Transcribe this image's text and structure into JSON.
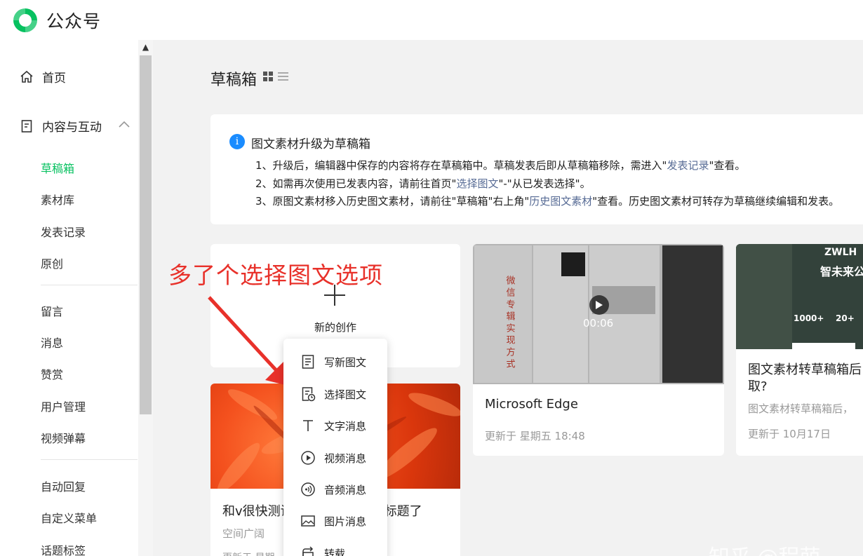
{
  "header": {
    "app_title": "公众号"
  },
  "sidebar": {
    "home_label": "首页",
    "content_label": "内容与互动",
    "items": [
      {
        "label": "草稿箱"
      },
      {
        "label": "素材库"
      },
      {
        "label": "发表记录"
      },
      {
        "label": "原创"
      },
      {
        "label": "留言"
      },
      {
        "label": "消息"
      },
      {
        "label": "赞赏"
      },
      {
        "label": "用户管理"
      },
      {
        "label": "视频弹幕"
      },
      {
        "label": "自动回复"
      },
      {
        "label": "自定义菜单"
      },
      {
        "label": "话题标签"
      }
    ],
    "active_item": "草稿箱"
  },
  "main": {
    "title": "草稿箱",
    "notice": {
      "title": "图文素材升级为草稿箱",
      "line1_a": "1、升级后，编辑器中保存的内容将存在草稿箱中。草稿发表后即从草稿箱移除，需进入\"",
      "line1_link": "发表记录",
      "line1_b": "\"查看。",
      "line2_a": "2、如需再次使用已发表内容，请前往首页\"",
      "line2_link": "选择图文",
      "line2_b": "\"-\"从已发表选择\"。",
      "line3_a": "3、原图文素材移入历史图文素材，请前往\"草稿箱\"右上角\"",
      "line3_link": "历史图文素材",
      "line3_b": "\"查看。历史图文素材可转存为草稿继续编辑和发表。"
    },
    "new_card_label": "新的创作",
    "annotation": "多了个选择图文选项",
    "menu": [
      {
        "label": "写新图文",
        "icon": "doc-icon"
      },
      {
        "label": "选择图文",
        "icon": "doc-clock-icon"
      },
      {
        "label": "文字消息",
        "icon": "text-icon"
      },
      {
        "label": "视频消息",
        "icon": "play-circle-icon"
      },
      {
        "label": "音频消息",
        "icon": "audio-icon"
      },
      {
        "label": "图片消息",
        "icon": "image-icon"
      },
      {
        "label": "转载",
        "icon": "repost-icon"
      }
    ],
    "cards": {
      "flower": {
        "title_a": "和v很快测试",
        "title_b": "标题了",
        "author": "空间广阔",
        "time": "更新于 星期"
      },
      "edge": {
        "title": "Microsoft Edge",
        "time": "更新于 星期五 18:48",
        "duration": "00:06",
        "thumb_text": "微信专辑实现方式"
      },
      "zw": {
        "brand": "ZWLH",
        "slogan": "智未来公众",
        "stat1": "1000+",
        "stat2": "20+",
        "title": "图文素材转草稿箱后",
        "title2": "取?",
        "desc": "图文素材转草稿箱后，",
        "time": "更新于 10月17日"
      }
    },
    "watermark": "知乎 @程萌"
  },
  "colors": {
    "accent": "#07c160",
    "link": "#576b95",
    "annotation": "#e8312a",
    "info": "#1a8cff"
  }
}
